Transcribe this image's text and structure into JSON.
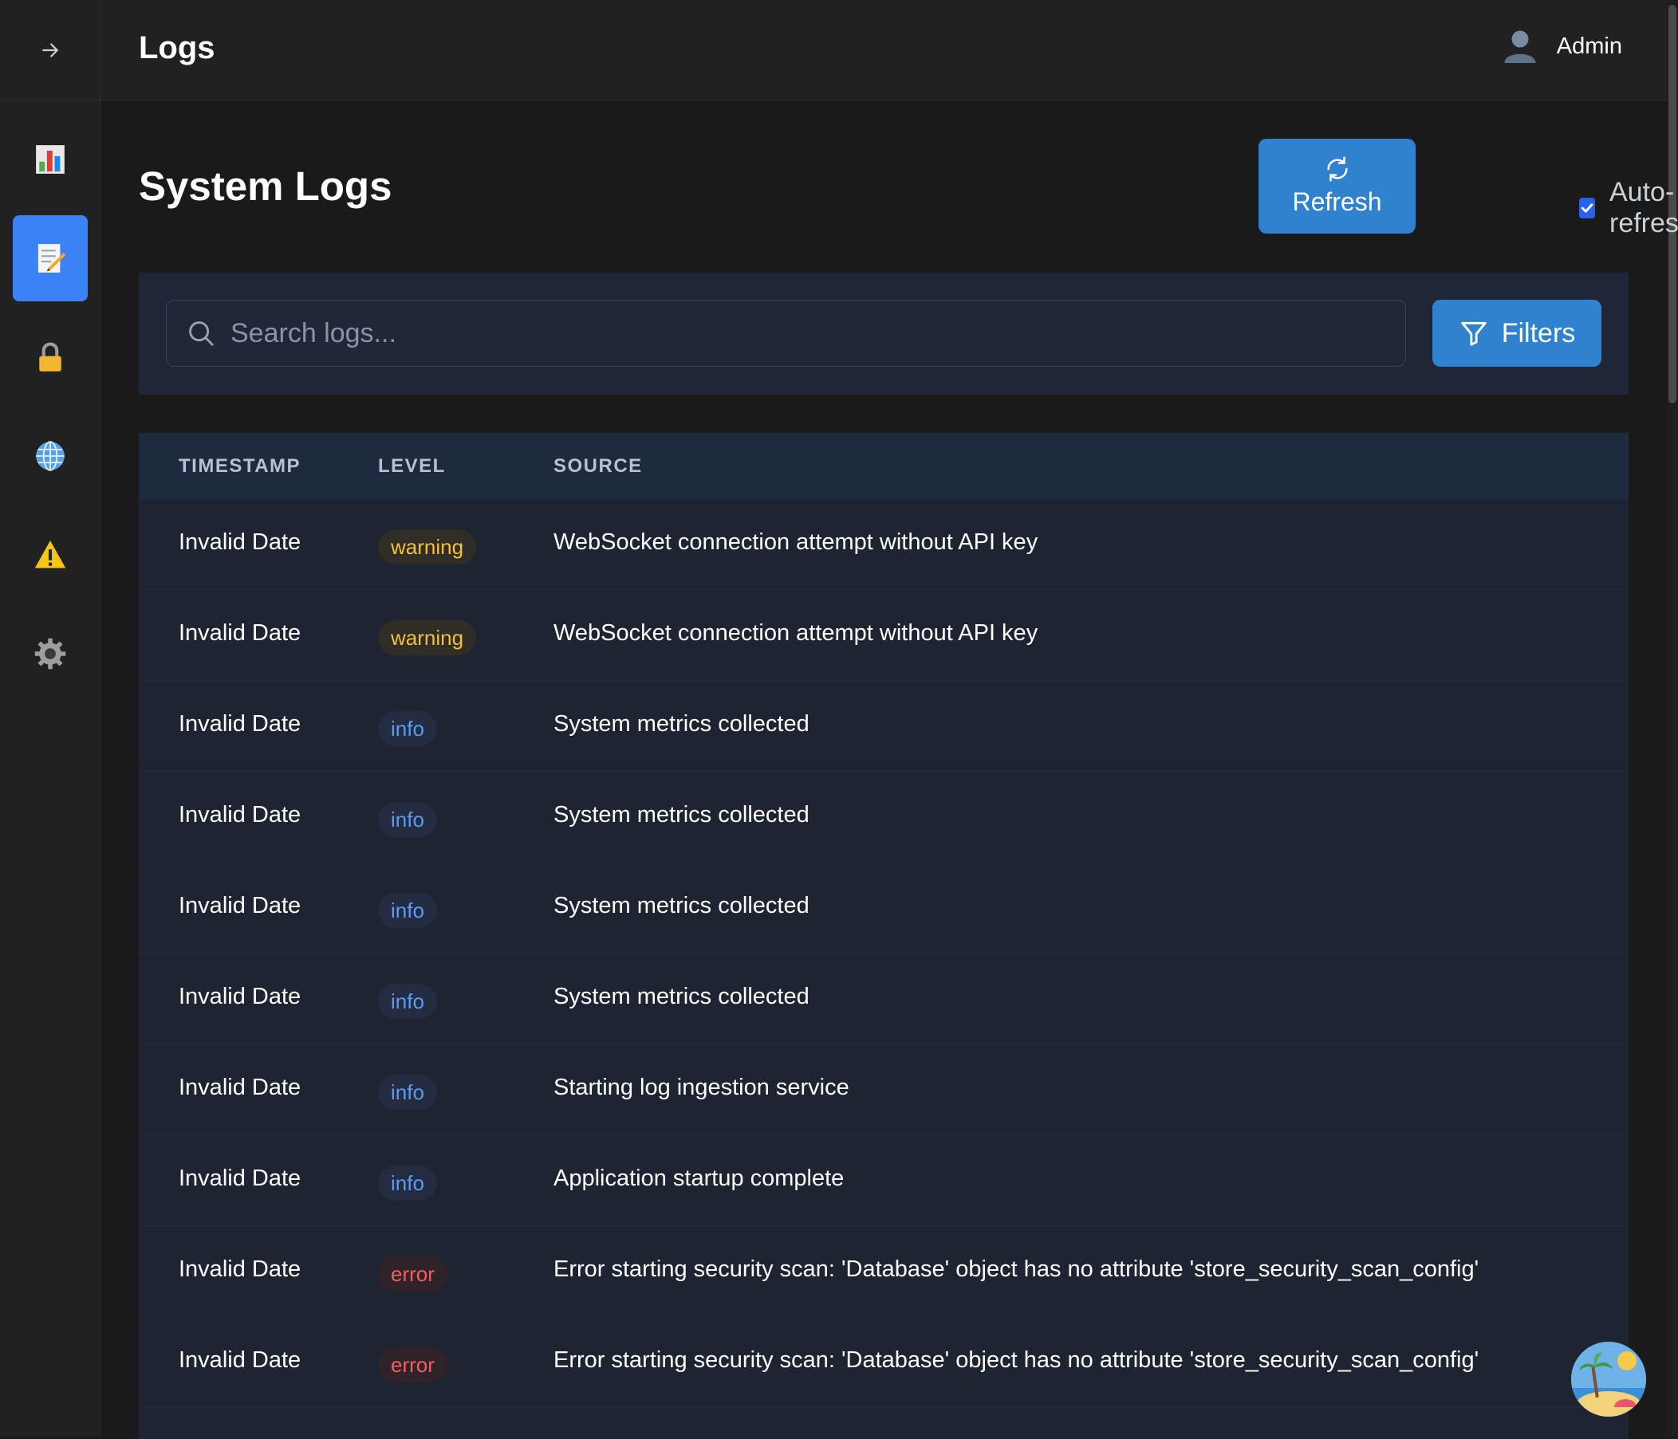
{
  "header": {
    "title": "Logs",
    "user_name": "Admin"
  },
  "sidebar": {
    "items": [
      {
        "icon": "bar-chart-icon",
        "active": false
      },
      {
        "icon": "memo-icon",
        "active": true
      },
      {
        "icon": "lock-icon",
        "active": false
      },
      {
        "icon": "globe-icon",
        "active": false
      },
      {
        "icon": "warning-icon",
        "active": false
      },
      {
        "icon": "gear-icon",
        "active": false
      }
    ]
  },
  "page": {
    "title": "System Logs",
    "refresh_label": "Refresh",
    "auto_refresh_label": "Auto-refresh",
    "auto_refresh_checked": true
  },
  "search": {
    "placeholder": "Search logs...",
    "filters_label": "Filters"
  },
  "table": {
    "columns": [
      "TIMESTAMP",
      "LEVEL",
      "SOURCE"
    ],
    "rows": [
      {
        "timestamp": "Invalid Date",
        "level": "warning",
        "source": "WebSocket connection attempt without API key"
      },
      {
        "timestamp": "Invalid Date",
        "level": "warning",
        "source": "WebSocket connection attempt without API key"
      },
      {
        "timestamp": "Invalid Date",
        "level": "info",
        "source": "System metrics collected"
      },
      {
        "timestamp": "Invalid Date",
        "level": "info",
        "source": "System metrics collected"
      },
      {
        "timestamp": "Invalid Date",
        "level": "info",
        "source": "System metrics collected"
      },
      {
        "timestamp": "Invalid Date",
        "level": "info",
        "source": "System metrics collected"
      },
      {
        "timestamp": "Invalid Date",
        "level": "info",
        "source": "Starting log ingestion service"
      },
      {
        "timestamp": "Invalid Date",
        "level": "info",
        "source": "Application startup complete"
      },
      {
        "timestamp": "Invalid Date",
        "level": "error",
        "source": "Error starting security scan: 'Database' object has no attribute 'store_security_scan_config'"
      },
      {
        "timestamp": "Invalid Date",
        "level": "error",
        "source": "Error starting security scan: 'Database' object has no attribute 'store_security_scan_config'"
      }
    ]
  },
  "colors": {
    "accent": "#3182ce",
    "active_nav": "#3b82f6",
    "warning": "#f0c040",
    "info": "#5b9cf2",
    "error": "#f06060"
  }
}
